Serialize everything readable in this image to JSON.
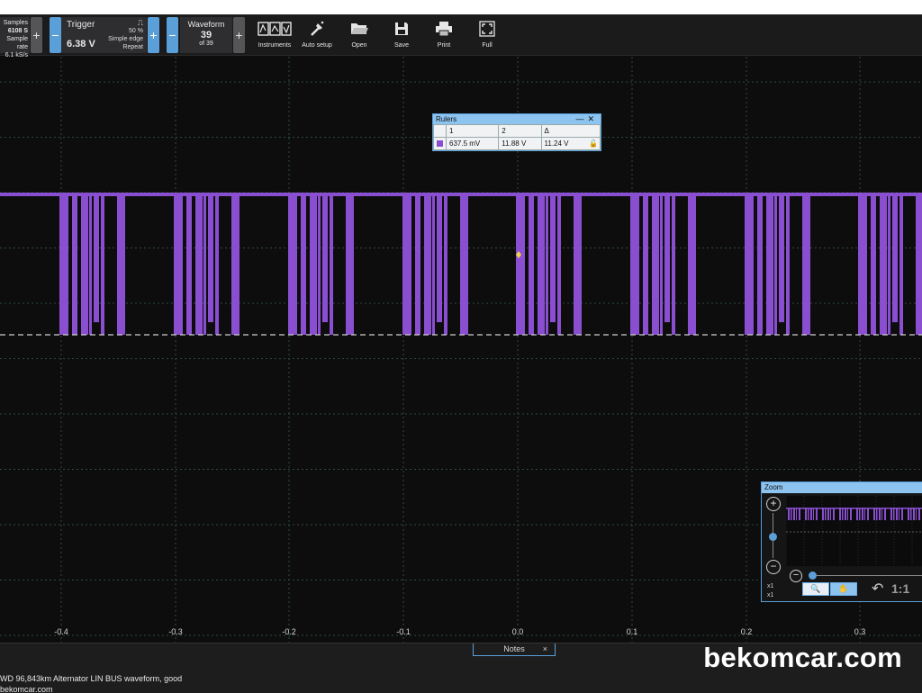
{
  "toolbar": {
    "samples": {
      "label": "Samples",
      "value": "6108 S",
      "rate_label": "Sample rate",
      "rate": "6.1 kS/s"
    },
    "trigger": {
      "title": "Trigger",
      "value": "6.38 V",
      "percent": "50 %",
      "mode": "Simple edge",
      "repeat": "Repeat"
    },
    "waveform": {
      "title": "Waveform",
      "number": "39",
      "of": "of 39"
    },
    "buttons": {
      "minus": "−",
      "plus": "+"
    },
    "tools": [
      {
        "label": "Instruments",
        "icon": "instruments-icon"
      },
      {
        "label": "Auto setup",
        "icon": "auto-setup-icon"
      },
      {
        "label": "Open",
        "icon": "folder-open-icon"
      },
      {
        "label": "Save",
        "icon": "save-icon"
      },
      {
        "label": "Print",
        "icon": "print-icon"
      },
      {
        "label": "Full",
        "icon": "fullscreen-icon"
      }
    ]
  },
  "rulers": {
    "title": "Rulers",
    "col1": "1",
    "col2": "2",
    "col3": "Δ",
    "v1": "637.5 mV",
    "v2": "11.88 V",
    "delta": "11.24 V"
  },
  "zoom": {
    "title": "Zoom",
    "plus": "+",
    "minus": "−",
    "minus2": "−",
    "x1a": "x1",
    "x1b": "x1",
    "one_to_one": "1:1"
  },
  "xaxis": {
    "ticks": [
      "-0.4",
      "-0.3",
      "-0.2",
      "-0.1",
      "0.0",
      "0.1",
      "0.2",
      "0.3"
    ]
  },
  "notes": {
    "label": "Notes",
    "close": "×"
  },
  "caption": {
    "line1": "WD 96,843km Alternator LIN BUS waveform, good",
    "line2": "bekomcar.com"
  },
  "watermark": "bekomcar.com",
  "colors": {
    "signal": "#8a4fd0",
    "accent": "#5a9fd8",
    "background": "#0d0d0d"
  }
}
